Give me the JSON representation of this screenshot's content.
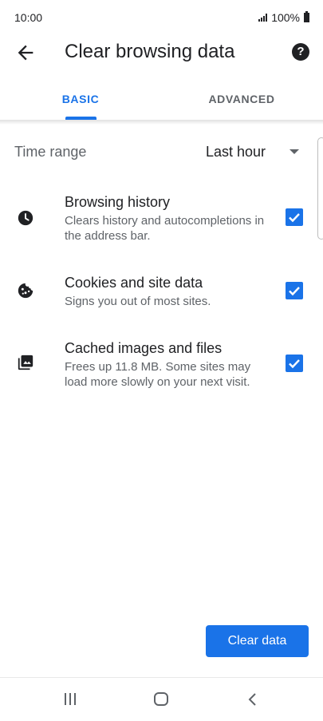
{
  "status": {
    "time": "10:00",
    "battery": "100%"
  },
  "appbar": {
    "title": "Clear browsing data"
  },
  "tabs": [
    {
      "label": "BASIC"
    },
    {
      "label": "ADVANCED"
    }
  ],
  "time_range": {
    "label": "Time range",
    "value": "Last hour"
  },
  "options": [
    {
      "title": "Browsing history",
      "description": "Clears history and autocompletions in the address bar.",
      "icon": "clock-icon",
      "checked": true
    },
    {
      "title": "Cookies and site data",
      "description": "Signs you out of most sites.",
      "icon": "cookie-icon",
      "checked": true
    },
    {
      "title": "Cached images and files",
      "description": "Frees up 11.8 MB. Some sites may load more slowly on your next visit.",
      "icon": "images-icon",
      "checked": true
    }
  ],
  "actions": {
    "clear_label": "Clear data"
  },
  "colors": {
    "accent": "#1a73e8",
    "text_primary": "#202124",
    "text_secondary": "#5f6368"
  }
}
